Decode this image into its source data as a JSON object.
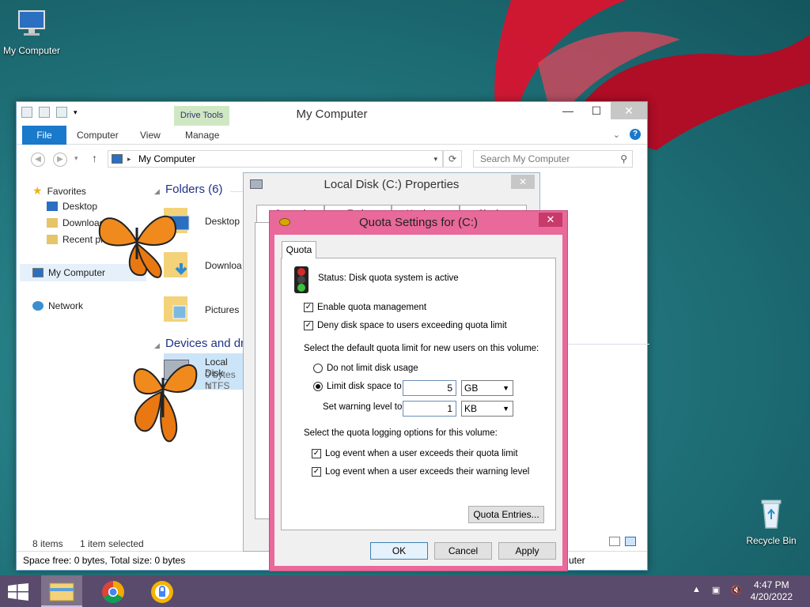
{
  "desktop": {
    "icons": [
      {
        "label": "My Computer"
      },
      {
        "label": "Recycle Bin"
      }
    ]
  },
  "explorer": {
    "title": "My Computer",
    "drive_tools_label": "Drive Tools",
    "tabs": [
      "File",
      "Computer",
      "View",
      "Manage"
    ],
    "address": "My Computer",
    "search_placeholder": "Search My Computer",
    "nav": {
      "favorites": "Favorites",
      "desktop": "Desktop",
      "downloads": "Downloads",
      "recent": "Recent pl",
      "my_computer": "My Computer",
      "network": "Network"
    },
    "folders_header": "Folders (6)",
    "folders": [
      "Desktop",
      "Downloa",
      "Pictures"
    ],
    "devices_header": "Devices and dr",
    "disk": {
      "name": "Local Disk",
      "free": "0 bytes fr",
      "fs": "NTFS"
    },
    "status_items": "8 items",
    "status_selected": "1 item selected",
    "footer": "Space free: 0 bytes, Total size: 0 bytes",
    "footer_right": "uter"
  },
  "properties": {
    "title": "Local Disk (C:) Properties",
    "tabs": [
      "General",
      "Tools",
      "Hardware",
      "Sharing"
    ]
  },
  "quota": {
    "title": "Quota Settings for  (C:)",
    "tab": "Quota",
    "status": "Status:  Disk quota system is active",
    "enable_label": "Enable quota management",
    "deny_label": "Deny disk space to users exceeding quota limit",
    "default_limit_label": "Select the default quota limit for new users on this volume:",
    "no_limit_label": "Do not limit disk usage",
    "limit_label": "Limit disk space to",
    "limit_value": "5",
    "limit_unit": "GB",
    "warning_label": "Set warning level to",
    "warning_value": "1",
    "warning_unit": "KB",
    "logging_label": "Select the quota logging options for this volume:",
    "log_quota_label": "Log event when a user exceeds their quota limit",
    "log_warning_label": "Log event when a user exceeds their warning level",
    "entries_button": "Quota Entries...",
    "ok": "OK",
    "cancel": "Cancel",
    "apply": "Apply"
  },
  "taskbar": {
    "time": "4:47 PM",
    "date": "4/20/2022"
  },
  "colors": {
    "accent": "#1979ca",
    "quota_frame": "#e8699a",
    "taskbar": "#5a4a6b"
  }
}
